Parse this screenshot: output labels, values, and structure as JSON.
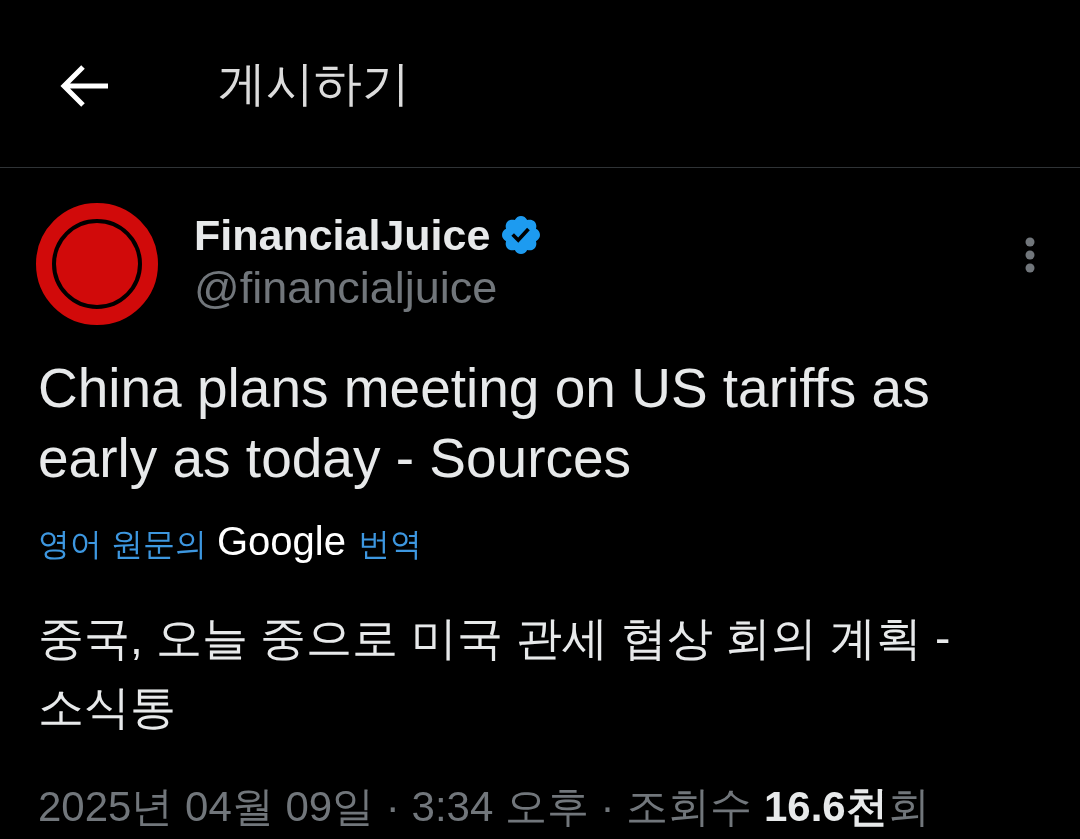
{
  "header": {
    "title": "게시하기"
  },
  "post": {
    "author": {
      "name": "FinancialJuice",
      "verified": true,
      "handle": "@financialjuice"
    },
    "text": "China plans meeting on US tariffs as early as today - Sources",
    "translation": {
      "prefix": "영어 원문의",
      "brand": "Google",
      "suffix": "번역"
    },
    "translated_text": "중국, 오늘 중으로 미국 관세 협상 회의 계획 - 소식통",
    "meta": "2025년 04월 09일 · 3:34 오후 · 조회수 **16.6천**회"
  }
}
